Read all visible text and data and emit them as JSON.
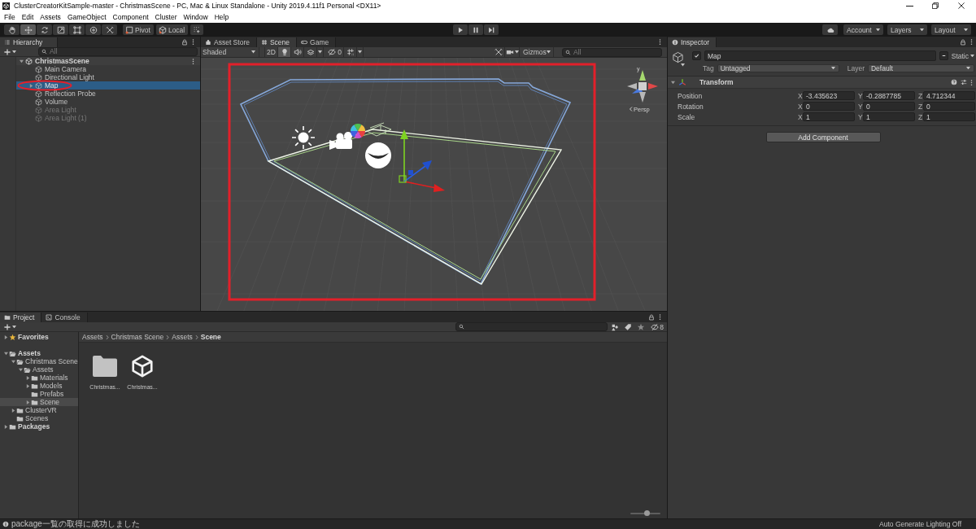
{
  "window": {
    "title": "ClusterCreatorKitSample-master - ChristmasScene - PC, Mac & Linux Standalone - Unity 2019.4.11f1 Personal <DX11>"
  },
  "menu": [
    "File",
    "Edit",
    "Assets",
    "GameObject",
    "Component",
    "Cluster",
    "Window",
    "Help"
  ],
  "toolbar": {
    "tools": [
      {
        "kind": "hand",
        "selected": false
      },
      {
        "kind": "move",
        "selected": true
      },
      {
        "kind": "rotate",
        "selected": false
      },
      {
        "kind": "scale",
        "selected": false
      },
      {
        "kind": "rect",
        "selected": false
      },
      {
        "kind": "transform",
        "selected": false
      },
      {
        "kind": "custom",
        "selected": false
      }
    ],
    "handle_buttons": [
      {
        "kind": "pivot",
        "label": "Pivot"
      },
      {
        "kind": "local",
        "label": "Local"
      }
    ],
    "playback": [
      {
        "kind": "play"
      },
      {
        "kind": "pause"
      },
      {
        "kind": "step"
      }
    ],
    "dropdowns": [
      "Account",
      "Layers",
      "Layout"
    ]
  },
  "hierarchy": {
    "tab": "Hierarchy",
    "search": {
      "placeholder": "All"
    },
    "tree": [
      {
        "label": "ChristmasScene",
        "kind": "scene",
        "expanded": true,
        "selected": false,
        "active": true,
        "children": [
          {
            "label": "Main Camera",
            "kind": "object",
            "selected": false,
            "active": true
          },
          {
            "label": "Directional Light",
            "kind": "object",
            "selected": false,
            "active": true
          },
          {
            "label": "Map",
            "kind": "object",
            "expanded": false,
            "selected": true,
            "active": true
          },
          {
            "label": "Reflection Probe",
            "kind": "object",
            "selected": false,
            "active": true
          },
          {
            "label": "Volume",
            "kind": "object",
            "selected": false,
            "active": true
          },
          {
            "label": "Area Light",
            "kind": "object",
            "selected": false,
            "active": false
          },
          {
            "label": "Area Light (1)",
            "kind": "object",
            "selected": false,
            "active": false
          }
        ]
      }
    ]
  },
  "scene": {
    "tabs": [
      {
        "label": "Asset Store",
        "kind": "store",
        "selected": false
      },
      {
        "label": "Scene",
        "kind": "scene",
        "selected": true
      },
      {
        "label": "Game",
        "kind": "game",
        "selected": false
      }
    ],
    "toolbar": {
      "shading": "Shaded",
      "mode_2d": {
        "label": "2D",
        "on": false
      },
      "toggles": [
        {
          "kind": "lighting",
          "on": true
        },
        {
          "kind": "audio",
          "on": false
        },
        {
          "kind": "effects",
          "on": false
        }
      ],
      "hidden_count": "0",
      "gizmos": "Gizmos",
      "search": {
        "placeholder": "All"
      }
    },
    "view": {
      "axis_label": "y",
      "projection": "Persp"
    }
  },
  "inspector": {
    "tab": "Inspector",
    "object": {
      "active": true,
      "name": "Map",
      "static_mixed": true,
      "static_label": "Static",
      "tag_label": "Tag",
      "tag": "Untagged",
      "layer_label": "Layer",
      "layer": "Default"
    },
    "components": [
      {
        "title": "Transform",
        "expanded": true,
        "rows": [
          {
            "label": "Position",
            "fields": [
              {
                "axis": "X",
                "value": "-3.435623"
              },
              {
                "axis": "Y",
                "value": "-0.2887785"
              },
              {
                "axis": "Z",
                "value": "4.712344"
              }
            ]
          },
          {
            "label": "Rotation",
            "fields": [
              {
                "axis": "X",
                "value": "0"
              },
              {
                "axis": "Y",
                "value": "0"
              },
              {
                "axis": "Z",
                "value": "0"
              }
            ]
          },
          {
            "label": "Scale",
            "fields": [
              {
                "axis": "X",
                "value": "1"
              },
              {
                "axis": "Y",
                "value": "1"
              },
              {
                "axis": "Z",
                "value": "1"
              }
            ]
          }
        ]
      }
    ],
    "add_component": "Add Component"
  },
  "project": {
    "tabs": [
      {
        "label": "Project",
        "kind": "project",
        "selected": true
      },
      {
        "label": "Console",
        "kind": "console",
        "selected": false
      }
    ],
    "hidden_count": "8",
    "tree": [
      {
        "label": "Favorites",
        "kind": "favorites",
        "expanded": false,
        "selected": false
      },
      {
        "label": "Assets",
        "kind": "folder",
        "expanded": true,
        "selected": false,
        "children": [
          {
            "label": "Christmas Scene",
            "kind": "folder",
            "expanded": true,
            "selected": false,
            "children": [
              {
                "label": "Assets",
                "kind": "folder",
                "expanded": true,
                "selected": false,
                "children": [
                  {
                    "label": "Materials",
                    "kind": "folder",
                    "expanded": false,
                    "selected": false
                  },
                  {
                    "label": "Models",
                    "kind": "folder",
                    "expanded": false,
                    "selected": false
                  },
                  {
                    "label": "Prefabs",
                    "kind": "folder",
                    "selected": false
                  },
                  {
                    "label": "Scene",
                    "kind": "folder",
                    "expanded": false,
                    "selected": true
                  }
                ]
              }
            ]
          },
          {
            "label": "ClusterVR",
            "kind": "folder",
            "expanded": false,
            "selected": false
          },
          {
            "label": "Scenes",
            "kind": "folder",
            "selected": false
          }
        ]
      },
      {
        "label": "Packages",
        "kind": "folder",
        "expanded": false,
        "selected": false
      }
    ],
    "breadcrumb": [
      "Assets",
      "Christmas Scene",
      "Assets",
      "Scene"
    ],
    "items": [
      {
        "kind": "folder",
        "label": "Christmas..."
      },
      {
        "kind": "scene",
        "label": "Christmas..."
      }
    ],
    "icon_size": {
      "level": 0.55
    }
  },
  "status_bar": {
    "message": "package一覧の取得に成功しました",
    "lighting": "Auto Generate Lighting Off"
  }
}
